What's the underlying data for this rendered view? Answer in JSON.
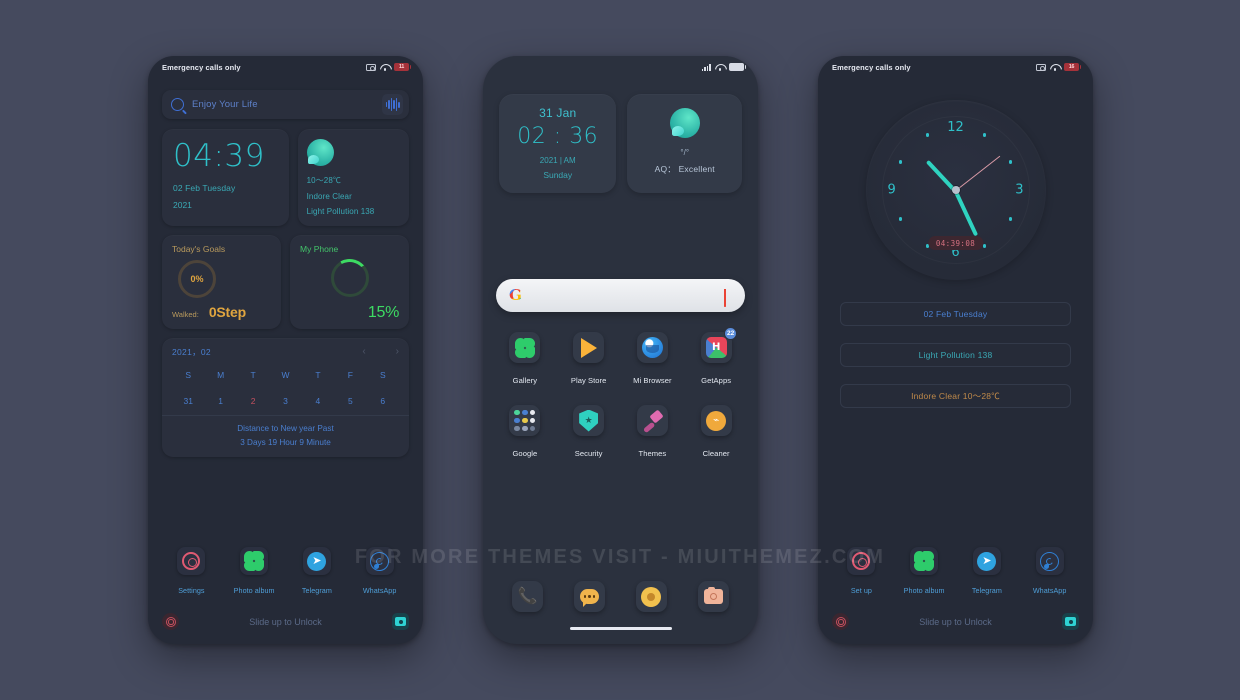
{
  "watermark": "FOR MORE THEMES VISIT - MIUITHEMEZ.COM",
  "colors": {
    "page_bg": "#454a5e",
    "phone_bg": "#252a37",
    "card_bg": "#2a2f3d",
    "accent_teal": "#2fc0c9",
    "accent_blue": "#4a7fd0",
    "accent_green": "#3ddb63",
    "accent_amber": "#e0a53f",
    "accent_orange": "#c08a4a",
    "accent_red": "#c4505e"
  },
  "lock_screen": {
    "status": {
      "carrier": "Emergency calls only",
      "battery_level": "11",
      "icons": [
        "camera-icon",
        "wifi-icon",
        "battery-icon"
      ]
    },
    "search": {
      "placeholder": "Enjoy Your Life",
      "search_icon": "search-icon",
      "voice_icon": "voice-wave-icon"
    },
    "clock_widget": {
      "time": "04:39",
      "date": "02 Feb Tuesday",
      "year": "2021"
    },
    "weather_widget": {
      "icon": "weather-orb-icon",
      "temp_range": "10〜28℃",
      "location_condition": "Indore  Clear",
      "pollution": "Light Pollution  138"
    },
    "goals_widget": {
      "title": "Today's Goals",
      "percent": "0%",
      "walked_label": "Walked:",
      "steps": "0Step"
    },
    "phone_widget": {
      "title": "My Phone",
      "battery_percent": "15%"
    },
    "calendar": {
      "year_month": "2021，02",
      "prev_icon": "chevron-left-icon",
      "next_icon": "chevron-right-icon",
      "prev": "‹",
      "next": "›",
      "dow": [
        "S",
        "M",
        "T",
        "W",
        "T",
        "F",
        "S"
      ],
      "days": [
        "31",
        "1",
        "2",
        "3",
        "4",
        "5",
        "6"
      ],
      "today_index": 2,
      "footer_line1": "Distance to New year Past",
      "footer_line2": "3 Days 19 Hour 9 Minute"
    },
    "dock": [
      {
        "name": "Settings",
        "icon": "settings-icon"
      },
      {
        "name": "Photo album",
        "icon": "clover-gallery-icon"
      },
      {
        "name": "Telegram",
        "icon": "telegram-icon"
      },
      {
        "name": "WhatsApp",
        "icon": "whatsapp-icon"
      }
    ],
    "unlock_text": "Slide up to Unlock",
    "corner_left_icon": "settings-shortcut-icon",
    "corner_right_icon": "camera-shortcut-icon"
  },
  "home_screen": {
    "status": {
      "icons": [
        "signal-bars-icon",
        "wifi-icon",
        "battery-icon"
      ]
    },
    "clock_widget": {
      "day": "31 Jan",
      "time": "02 : 36",
      "year_ampm": "2021 | AM",
      "weekday": "Sunday"
    },
    "aq_widget": {
      "icon": "weather-orb-icon",
      "degrees": "°/°",
      "label": "AQ：  Excellent"
    },
    "search": {
      "logo": "google-g-icon",
      "mic": "microphone-icon"
    },
    "apps_row1": [
      {
        "name": "Gallery",
        "icon": "clover-gallery-icon"
      },
      {
        "name": "Play Store",
        "icon": "play-store-icon"
      },
      {
        "name": "Mi Browser",
        "icon": "mi-browser-icon"
      },
      {
        "name": "GetApps",
        "icon": "getapps-icon",
        "badge": "22"
      }
    ],
    "apps_row2": [
      {
        "name": "Google",
        "icon": "google-folder-icon"
      },
      {
        "name": "Security",
        "icon": "security-shield-icon"
      },
      {
        "name": "Themes",
        "icon": "themes-brush-icon"
      },
      {
        "name": "Cleaner",
        "icon": "cleaner-icon"
      }
    ],
    "dock": [
      {
        "name": "Phone",
        "icon": "phone-icon"
      },
      {
        "name": "Messages",
        "icon": "messages-icon"
      },
      {
        "name": "Camera Ring",
        "icon": "camera-ring-icon"
      },
      {
        "name": "Camera",
        "icon": "camera-icon"
      }
    ]
  },
  "clock_screen": {
    "status": {
      "carrier": "Emergency calls only",
      "battery_level": "16",
      "icons": [
        "camera-icon",
        "wifi-icon",
        "battery-icon"
      ]
    },
    "analog_clock": {
      "numerals": [
        "12",
        "3",
        "6",
        "9"
      ],
      "digital_time": "04:39:08"
    },
    "pills": [
      {
        "text": "02 Feb Tuesday",
        "style": "pill-date"
      },
      {
        "text": "Light Pollution  138",
        "style": "pill-poll"
      },
      {
        "text": "Indore  Clear  10〜28℃",
        "style": "pill-wx"
      }
    ],
    "dock": [
      {
        "name": "Set up",
        "icon": "settings-icon"
      },
      {
        "name": "Photo album",
        "icon": "clover-gallery-icon"
      },
      {
        "name": "Telegram",
        "icon": "telegram-icon"
      },
      {
        "name": "WhatsApp",
        "icon": "whatsapp-icon"
      }
    ],
    "unlock_text": "Slide up to Unlock",
    "corner_left_icon": "settings-shortcut-icon",
    "corner_right_icon": "camera-shortcut-icon"
  }
}
